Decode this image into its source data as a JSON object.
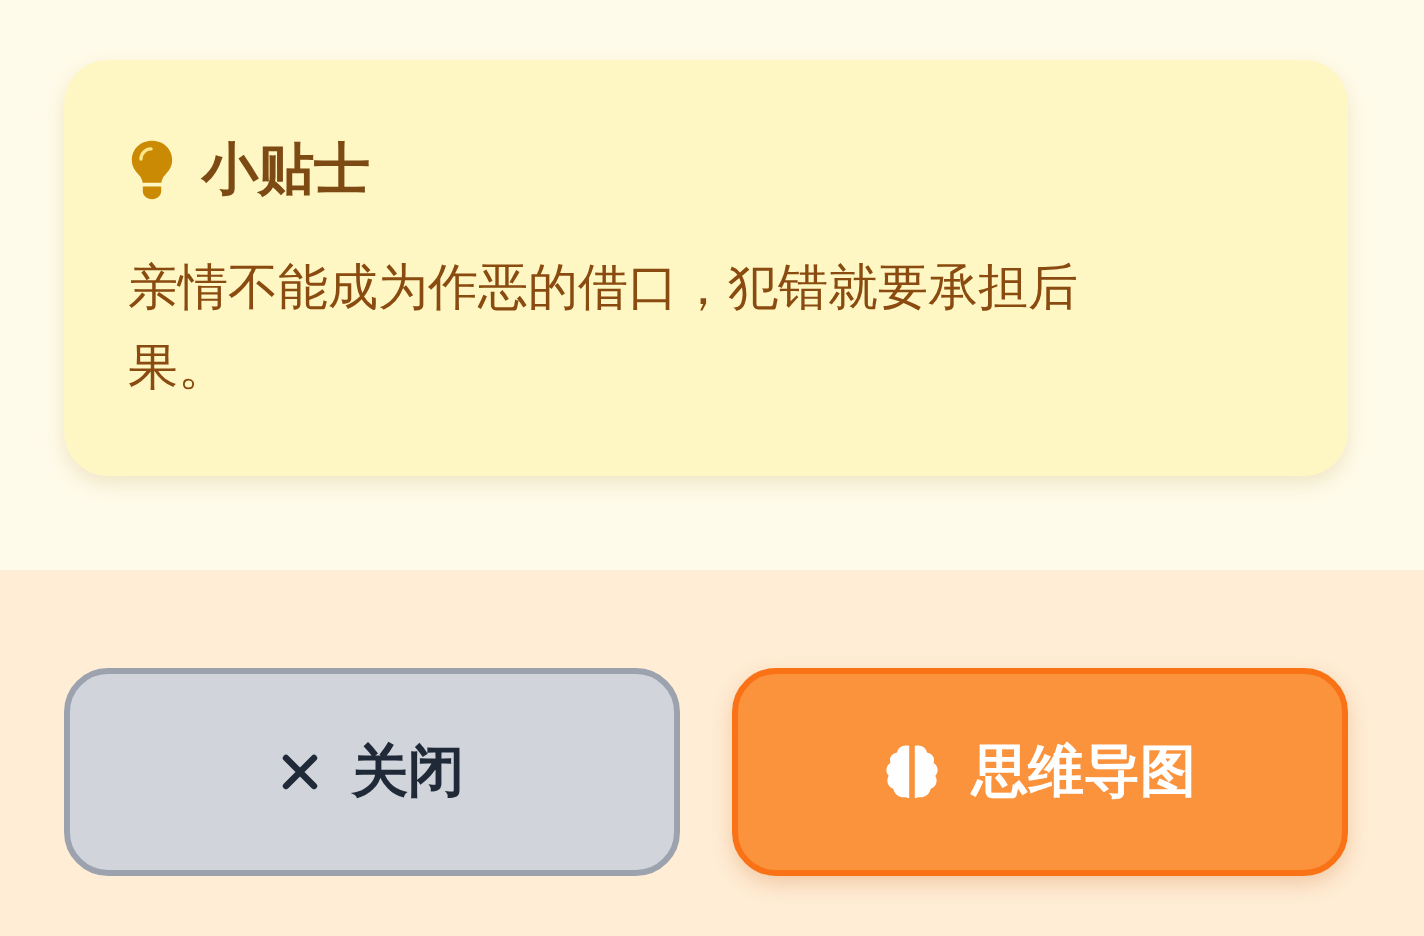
{
  "tip": {
    "title": "小贴士",
    "body": "亲情不能成为作恶的借口，犯错就要承担后果。"
  },
  "buttons": [
    {
      "label": "关闭",
      "kind": "close"
    },
    {
      "label": "思维导图",
      "kind": "mindmap"
    }
  ]
}
